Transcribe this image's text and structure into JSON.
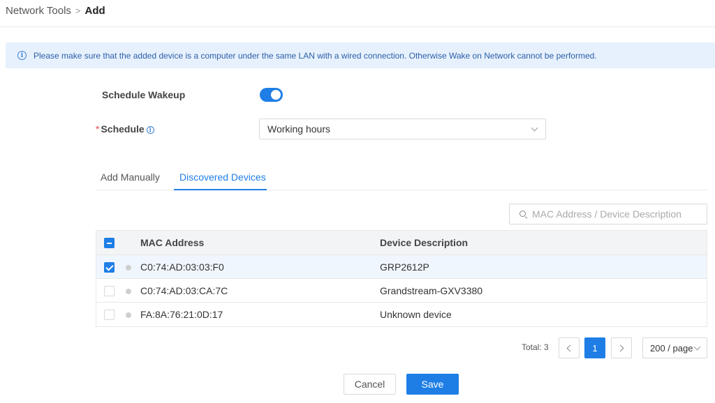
{
  "breadcrumb": {
    "parent": "Network Tools",
    "separator": ">",
    "current": "Add"
  },
  "notice": {
    "icon": "info-icon",
    "text": "Please make sure that the added device is a computer under the same LAN with a wired connection. Otherwise Wake on Network cannot be performed."
  },
  "form": {
    "schedule_wakeup_label": "Schedule Wakeup",
    "schedule_wakeup_enabled": true,
    "schedule_required_mark": "*",
    "schedule_label": "Schedule",
    "schedule_value": "Working hours"
  },
  "tabs": [
    {
      "label": "Add Manually",
      "active": false
    },
    {
      "label": "Discovered Devices",
      "active": true
    }
  ],
  "search": {
    "placeholder": "MAC Address / Device Description"
  },
  "table": {
    "columns": [
      "MAC Address",
      "Device Description"
    ],
    "rows": [
      {
        "mac": "C0:74:AD:03:03:F0",
        "description": "GRP2612P",
        "checked": true
      },
      {
        "mac": "C0:74:AD:03:CA:7C",
        "description": "Grandstream-GXV3380",
        "checked": false
      },
      {
        "mac": "FA:8A:76:21:0D:17",
        "description": "Unknown device",
        "checked": false
      }
    ]
  },
  "pagination": {
    "total_label": "Total: 3",
    "current_page": "1",
    "page_size": "200 / page"
  },
  "buttons": {
    "cancel": "Cancel",
    "save": "Save"
  },
  "colors": {
    "accent": "#1e7ee6",
    "notice_bg": "#e7f1fd",
    "required": "#e5484d"
  }
}
